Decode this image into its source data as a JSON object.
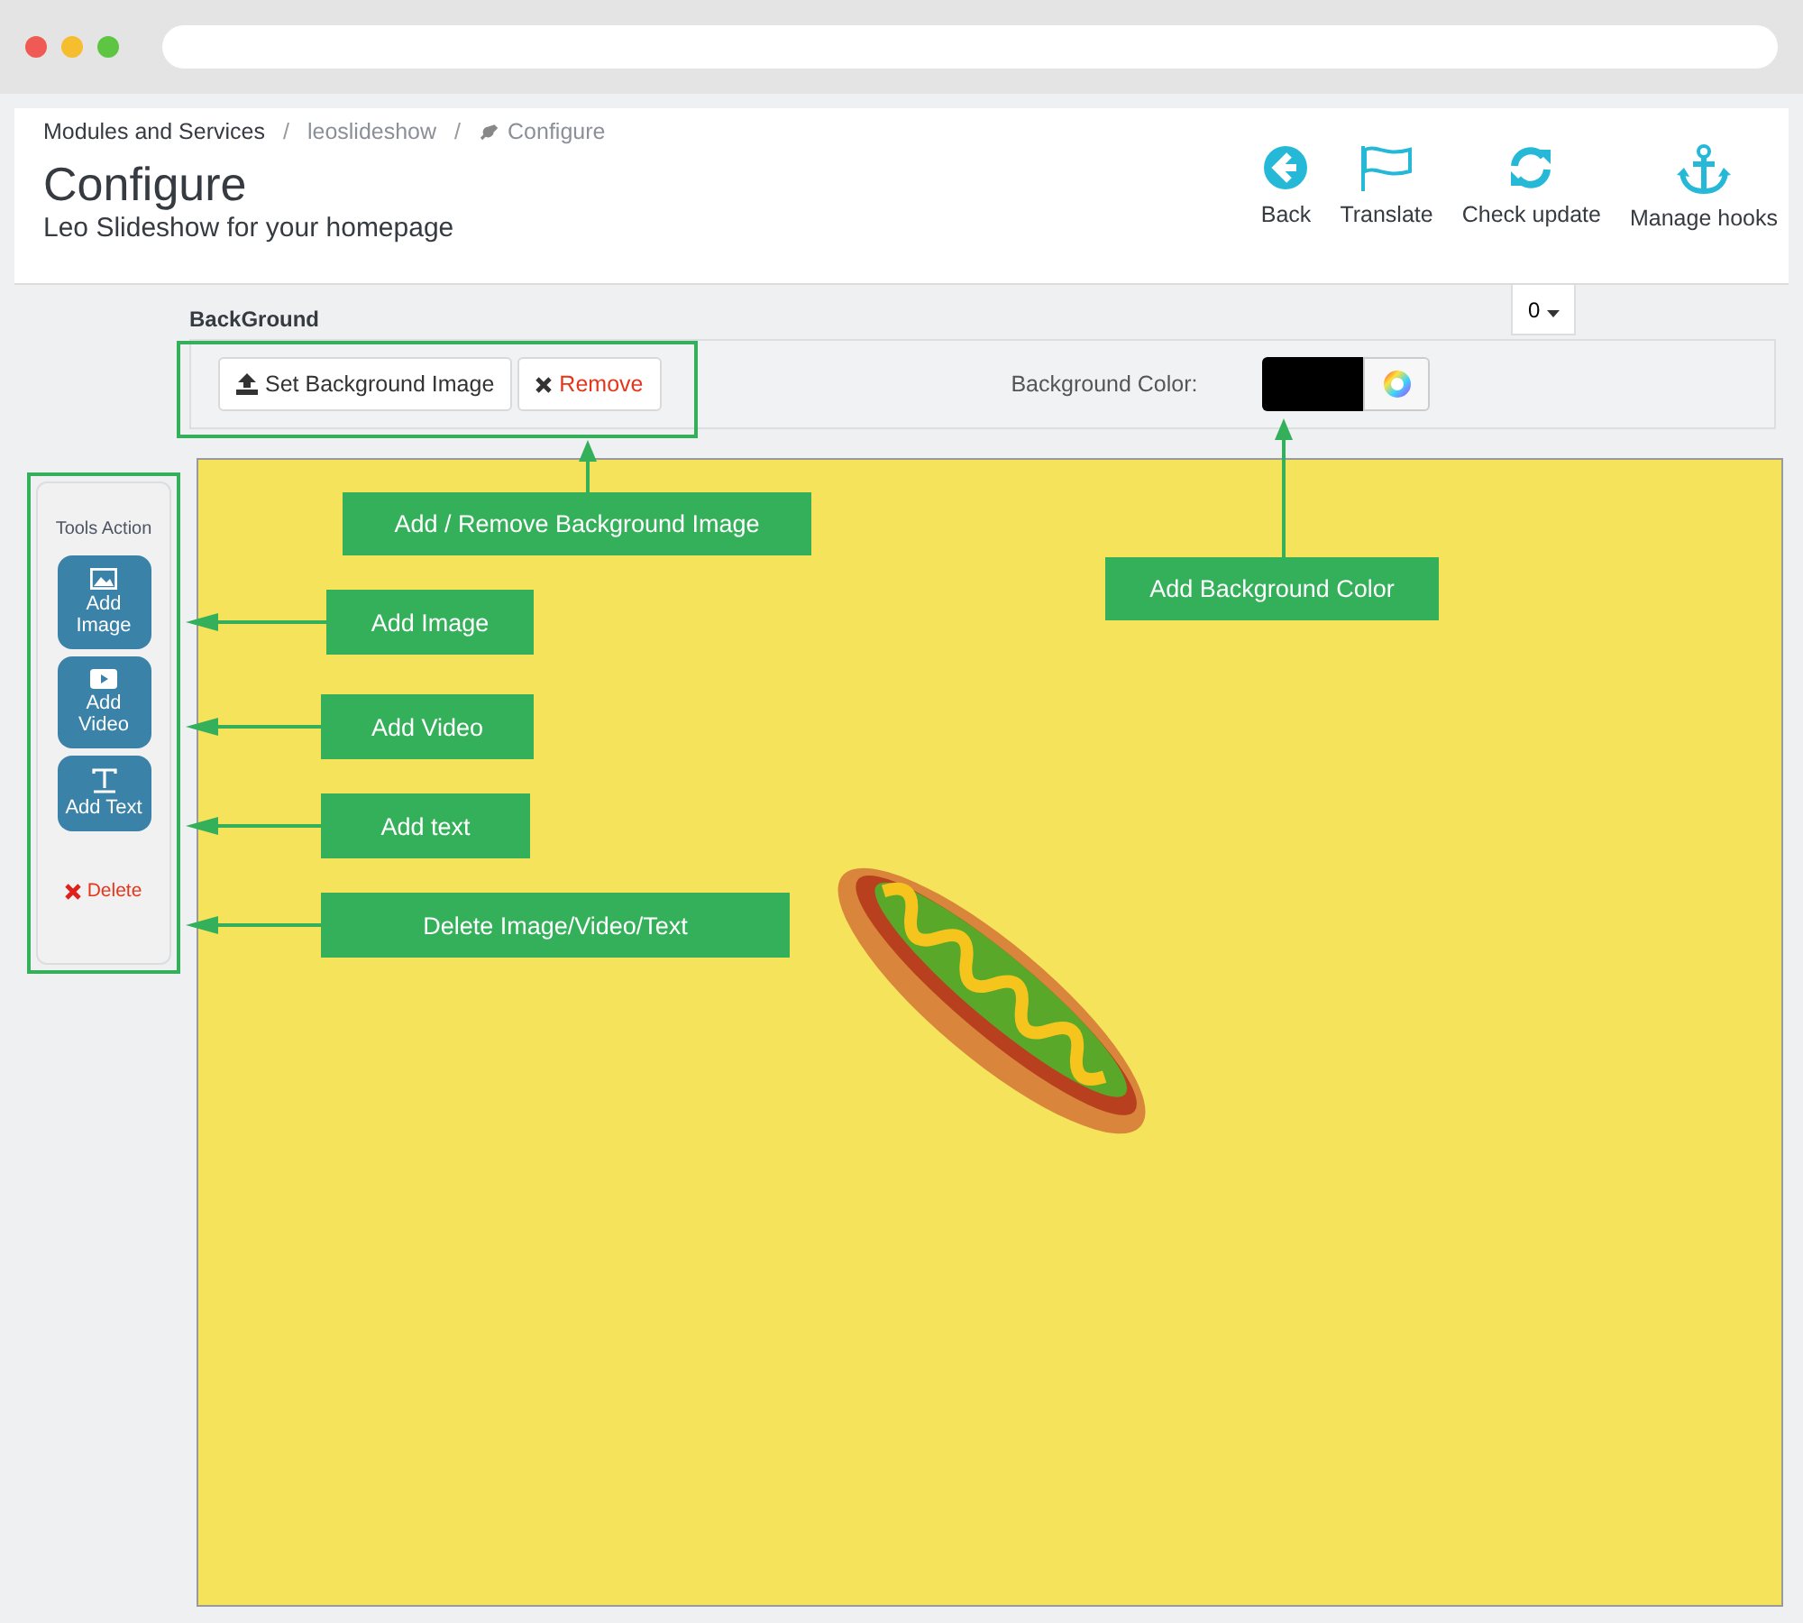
{
  "breadcrumb": [
    {
      "label": "Modules and Services",
      "separator": "/"
    },
    {
      "label": "leoslideshow",
      "separator": "/"
    },
    {
      "label": "Configure"
    }
  ],
  "page": {
    "title": "Configure",
    "subtitle": "Leo Slideshow for your homepage"
  },
  "toolbar": [
    {
      "label": "Back",
      "kind": "back"
    },
    {
      "label": "Translate",
      "kind": "flag"
    },
    {
      "label": "Check update",
      "kind": "refresh"
    },
    {
      "label": "Manage hooks",
      "kind": "anchor"
    }
  ],
  "language_dropdown": {
    "value": "0"
  },
  "background": {
    "heading": "BackGround",
    "set_button": "Set Background Image",
    "remove_button": "Remove",
    "color_label": "Background Color:",
    "color": "#000000"
  },
  "tools": {
    "title": "Tools Action",
    "items": [
      {
        "label": "Add Image",
        "kind": "image"
      },
      {
        "label": "Add Video",
        "kind": "video"
      },
      {
        "label": "Add Text",
        "kind": "text"
      }
    ],
    "delete": "Delete"
  },
  "callouts": [
    {
      "text": "Add / Remove Background Image",
      "kind": "up"
    },
    {
      "text": "Add Background Color",
      "kind": "up"
    },
    {
      "text": "Add Image",
      "kind": "left"
    },
    {
      "text": "Add Video",
      "kind": "left"
    },
    {
      "text": "Add text",
      "kind": "left"
    },
    {
      "text": "Delete Image/Video/Text",
      "kind": "left"
    }
  ]
}
